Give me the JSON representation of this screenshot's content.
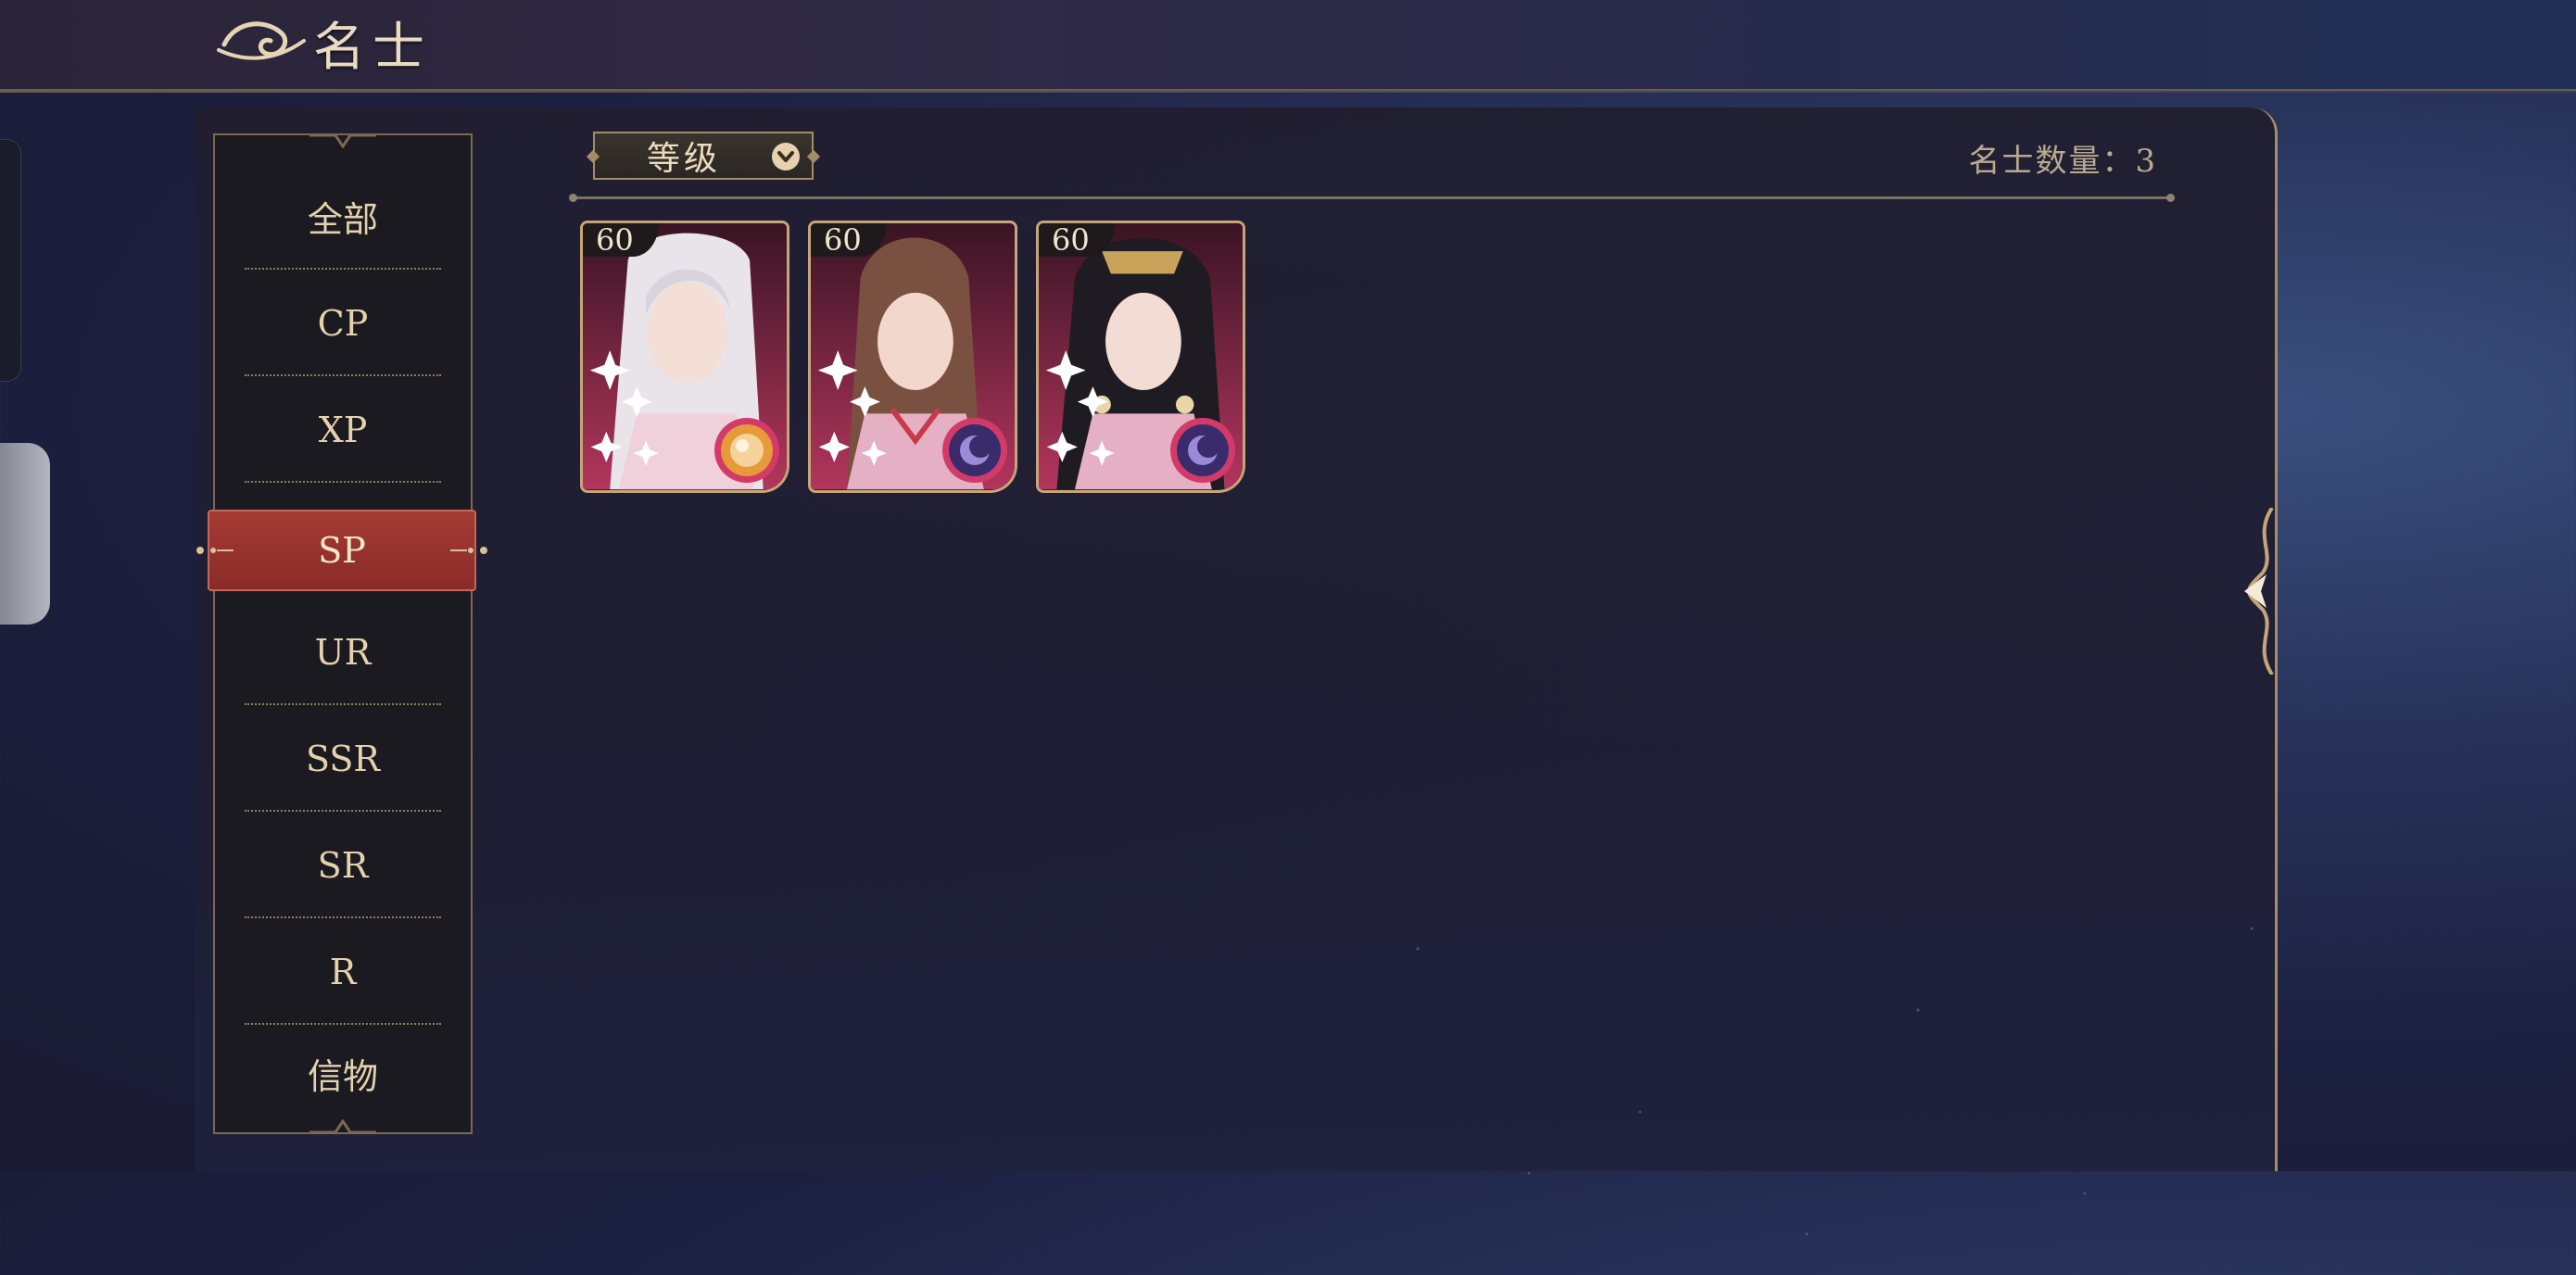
{
  "header": {
    "title": "名士"
  },
  "sidebar": {
    "items": [
      {
        "label": "全部",
        "active": false
      },
      {
        "label": "CP",
        "active": false
      },
      {
        "label": "XP",
        "active": false
      },
      {
        "label": "SP",
        "active": true
      },
      {
        "label": "UR",
        "active": false
      },
      {
        "label": "SSR",
        "active": false
      },
      {
        "label": "SR",
        "active": false
      },
      {
        "label": "R",
        "active": false
      },
      {
        "label": "信物",
        "active": false
      }
    ]
  },
  "filter": {
    "label": "等级"
  },
  "count_label": "名士数量：3",
  "cards": [
    {
      "level": "60",
      "badge": "gold-orb-icon",
      "hair": "#e8e4ea"
    },
    {
      "level": "60",
      "badge": "purple-moon-icon",
      "hair": "#7a5040"
    },
    {
      "level": "60",
      "badge": "purple-moon-icon",
      "hair": "#1e1c22"
    }
  ],
  "colors": {
    "accent_gold": "#c7a57a",
    "active_tab": "#a53a34",
    "text_gold": "#e4d2ad"
  }
}
